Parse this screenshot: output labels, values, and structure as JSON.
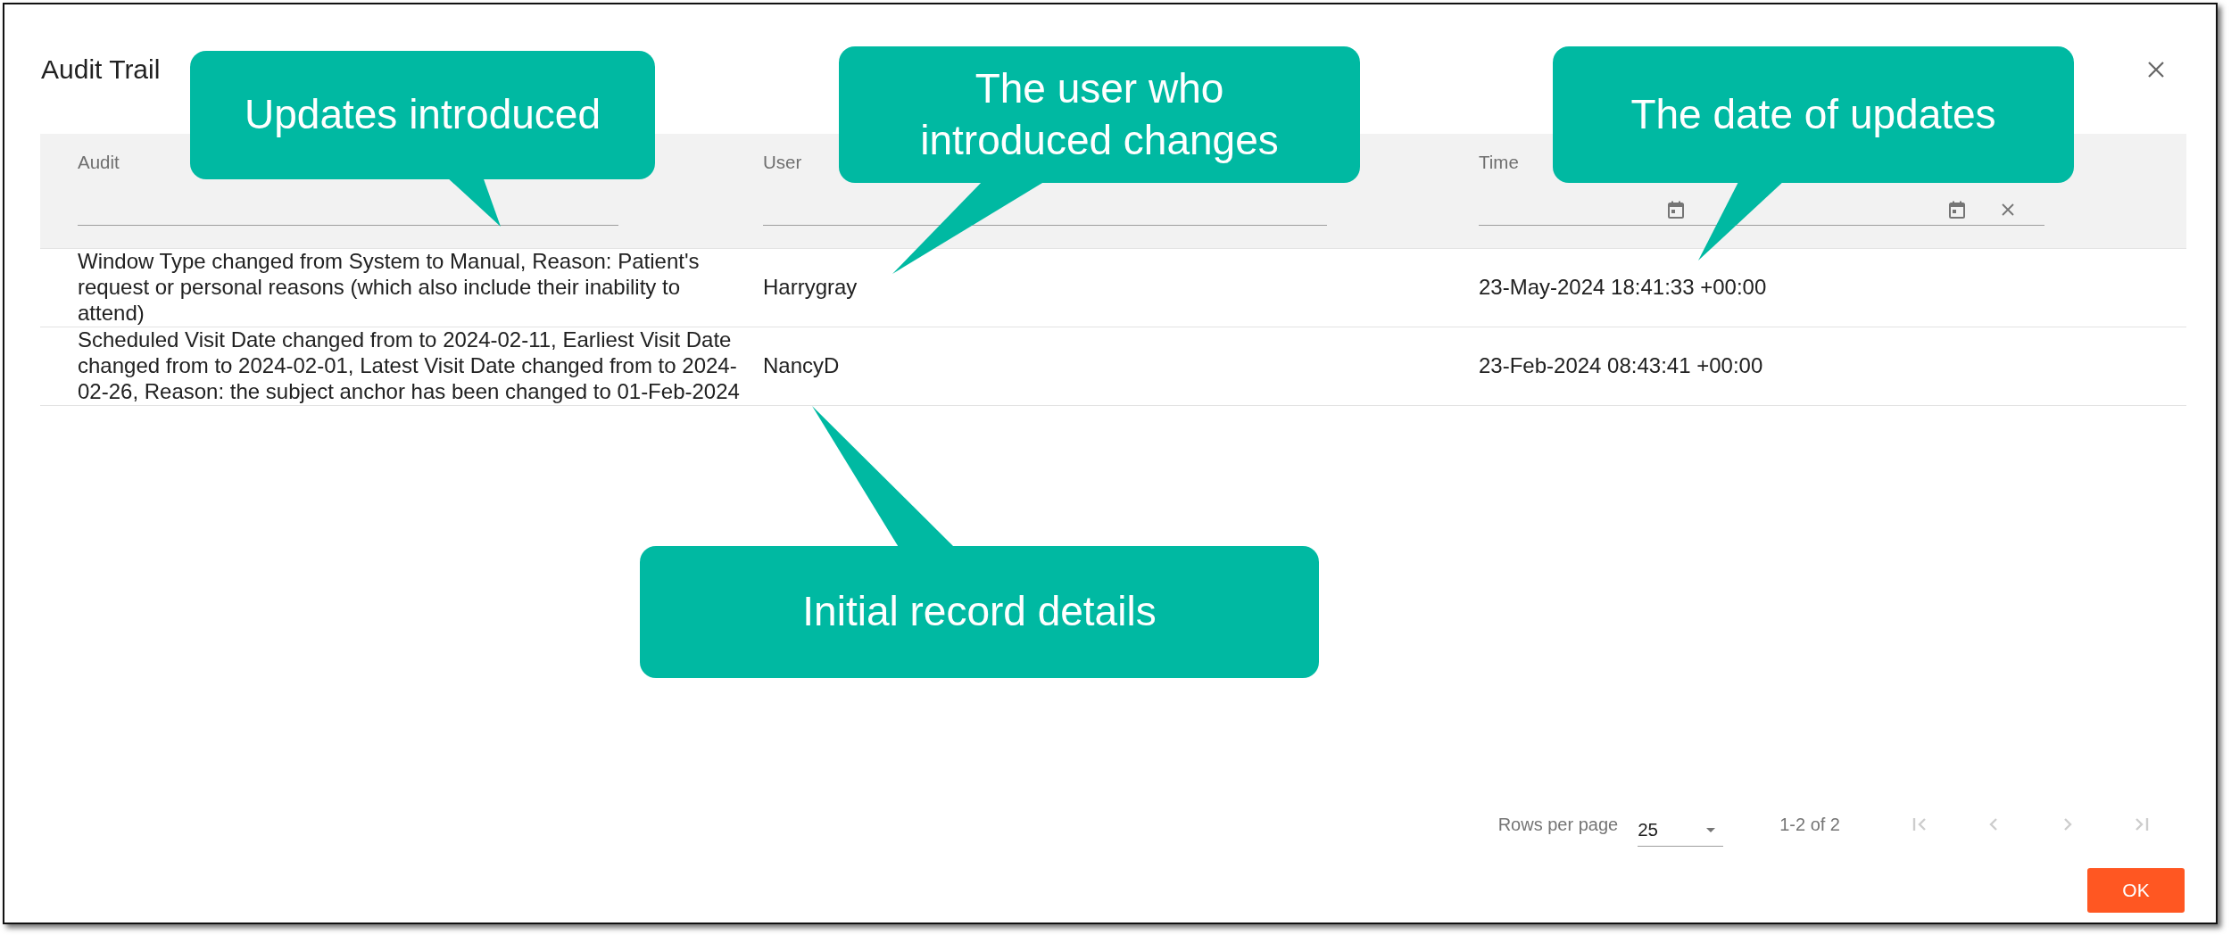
{
  "dialog": {
    "title": "Audit Trail"
  },
  "table": {
    "columns": [
      {
        "label": "Audit",
        "kind": "text"
      },
      {
        "label": "User",
        "kind": "text"
      },
      {
        "label": "Time",
        "kind": "date_range"
      }
    ],
    "rows": [
      {
        "cells": [
          "Window Type changed from System to Manual, Reason: Patient's request or personal reasons (which also include their inability to attend)",
          "Harrygray",
          "23-May-2024 18:41:33 +00:00"
        ]
      },
      {
        "cells": [
          "Scheduled Visit Date changed from to 2024-02-11, Earliest Visit Date changed from to 2024-02-01, Latest Visit Date changed from to 2024-02-26, Reason: the subject anchor has been changed to 01-Feb-2024",
          "NancyD",
          "23-Feb-2024 08:43:41 +00:00"
        ]
      }
    ]
  },
  "pagination": {
    "rows_per_page_label": "Rows per page",
    "rows_per_page": "25",
    "range": "1-2 of 2",
    "buttons": [
      {
        "kind": "first",
        "disabled": true
      },
      {
        "kind": "previous",
        "disabled": true
      },
      {
        "kind": "next",
        "disabled": true
      },
      {
        "kind": "last",
        "disabled": true
      }
    ]
  },
  "actions": [
    {
      "label": "OK"
    }
  ],
  "callouts": [
    {
      "text": "Updates introduced"
    },
    {
      "text": "The user who introduced changes"
    },
    {
      "text": "The date of updates"
    },
    {
      "text": "Initial record details"
    }
  ]
}
